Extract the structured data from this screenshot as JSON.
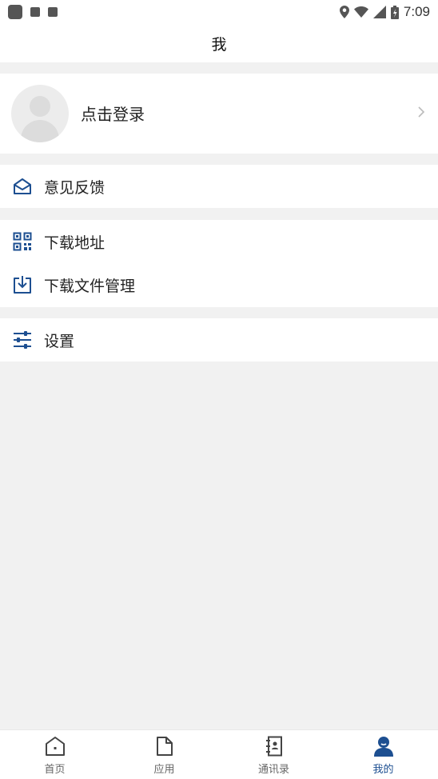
{
  "status_bar": {
    "time": "7:09"
  },
  "header": {
    "title": "我"
  },
  "login": {
    "label": "点击登录"
  },
  "menu": {
    "feedback": "意见反馈",
    "download_address": "下载地址",
    "download_file_manager": "下载文件管理",
    "settings": "设置"
  },
  "tabs": [
    {
      "label": "首页",
      "icon": "home-icon",
      "active": false
    },
    {
      "label": "应用",
      "icon": "document-icon",
      "active": false
    },
    {
      "label": "通讯录",
      "icon": "contacts-icon",
      "active": false
    },
    {
      "label": "我的",
      "icon": "user-icon",
      "active": true
    }
  ],
  "colors": {
    "accent": "#1d4f91",
    "background": "#f1f1f1"
  }
}
